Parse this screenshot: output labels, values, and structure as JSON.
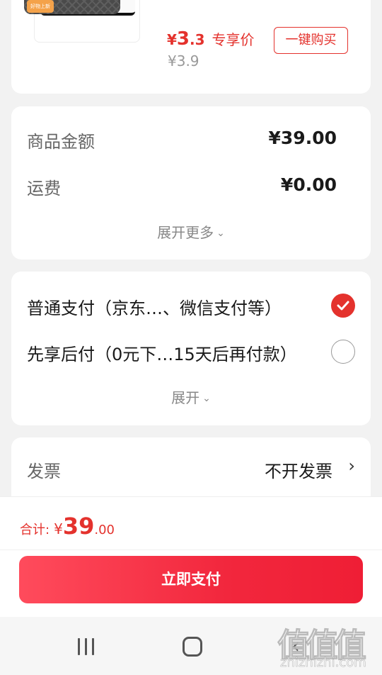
{
  "product": {
    "thumb_badge": "好物上新",
    "price_symbol": "¥",
    "price_int": "3",
    "price_dec": ".3",
    "price_tag": "专享价",
    "original_price": "¥3.9",
    "buy_button": "一键购买"
  },
  "summary": {
    "goods_label": "商品金额",
    "goods_value": "¥39.00",
    "shipping_label": "运费",
    "shipping_value": "¥0.00",
    "expand_label": "展开更多"
  },
  "payment": {
    "options": [
      {
        "label": "普通支付（京东…、微信支付等）",
        "selected": true
      },
      {
        "label": "先享后付（0元下…15天后再付款）",
        "selected": false
      }
    ],
    "expand_label": "展开"
  },
  "invoice": {
    "label": "发票",
    "value": "不开发票"
  },
  "footer": {
    "total_label": "合计:",
    "total_symbol": "¥",
    "total_int": "39",
    "total_dec": ".00",
    "pay_button": "立即支付"
  },
  "watermark": {
    "logo": "值值值",
    "site": "zhizhizhi.com"
  },
  "colors": {
    "accent": "#e4322d",
    "button_gradient_start": "#ff4b5c",
    "button_gradient_end": "#ef1e35"
  }
}
